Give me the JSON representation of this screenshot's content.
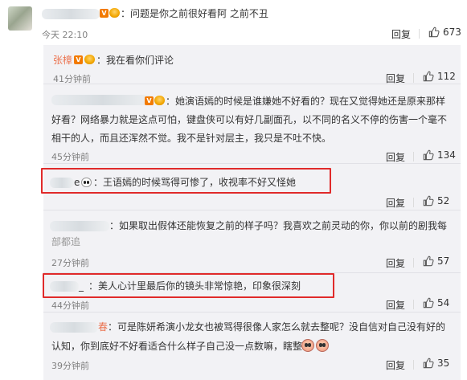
{
  "main": {
    "text_suffix": "：问题是你之前很好看阿 之前不丑",
    "time": "今天 22:10",
    "reply_label": "回复",
    "likes": "673"
  },
  "replies": [
    {
      "user": "张樟",
      "text": "：我在看你们评论",
      "time": "41分钟前",
      "reply_label": "回复",
      "likes": "112"
    },
    {
      "line1": "：她演语嫣的时候是谁嫌她不好看的？现在又觉得她还是原来那样",
      "line2": "好看？网络暴力就是这点可怕，键盘侠可以有好几副面孔，以不同的名义不停的伤害一个毫不",
      "line3": "相干的人，而且还浑然不觉。我不是针对层主，我只是不吐不快。",
      "time": "45分钟前",
      "reply_label": "回复",
      "likes": "134"
    },
    {
      "user_suffix": "e",
      "text": "：王语嫣的时候骂得可惨了，收视率不好又怪她",
      "reply_label": "回复",
      "likes": "52"
    },
    {
      "line1": "：如果取出假体还能恢复之前的样子吗？我喜欢之前灵动的你，你以前的剧我每",
      "line2": "部都追",
      "time": "27分钟前",
      "reply_label": "回复",
      "likes": "57"
    },
    {
      "user_suffix": "_",
      "text": "：美人心计里最后你的镜头非常惊艳，印象很深刻",
      "time": "44分钟前",
      "reply_label": "回复",
      "likes": "54"
    },
    {
      "user_suffix": "春",
      "line1": "：可是陈妍希演小龙女也被骂得很像人家怎么就去整呢？没自信对自己没有好的",
      "line2": "认知，你到底好不好看适合什么样子自己没一点数嘛，瞎整",
      "time": "39分钟前",
      "reply_label": "回复",
      "likes": "35"
    }
  ],
  "badges": {
    "vip": "V"
  },
  "colors": {
    "name": "#eb7350",
    "highlight": "#e02a2a",
    "reply_bg": "#f2f2f5"
  }
}
